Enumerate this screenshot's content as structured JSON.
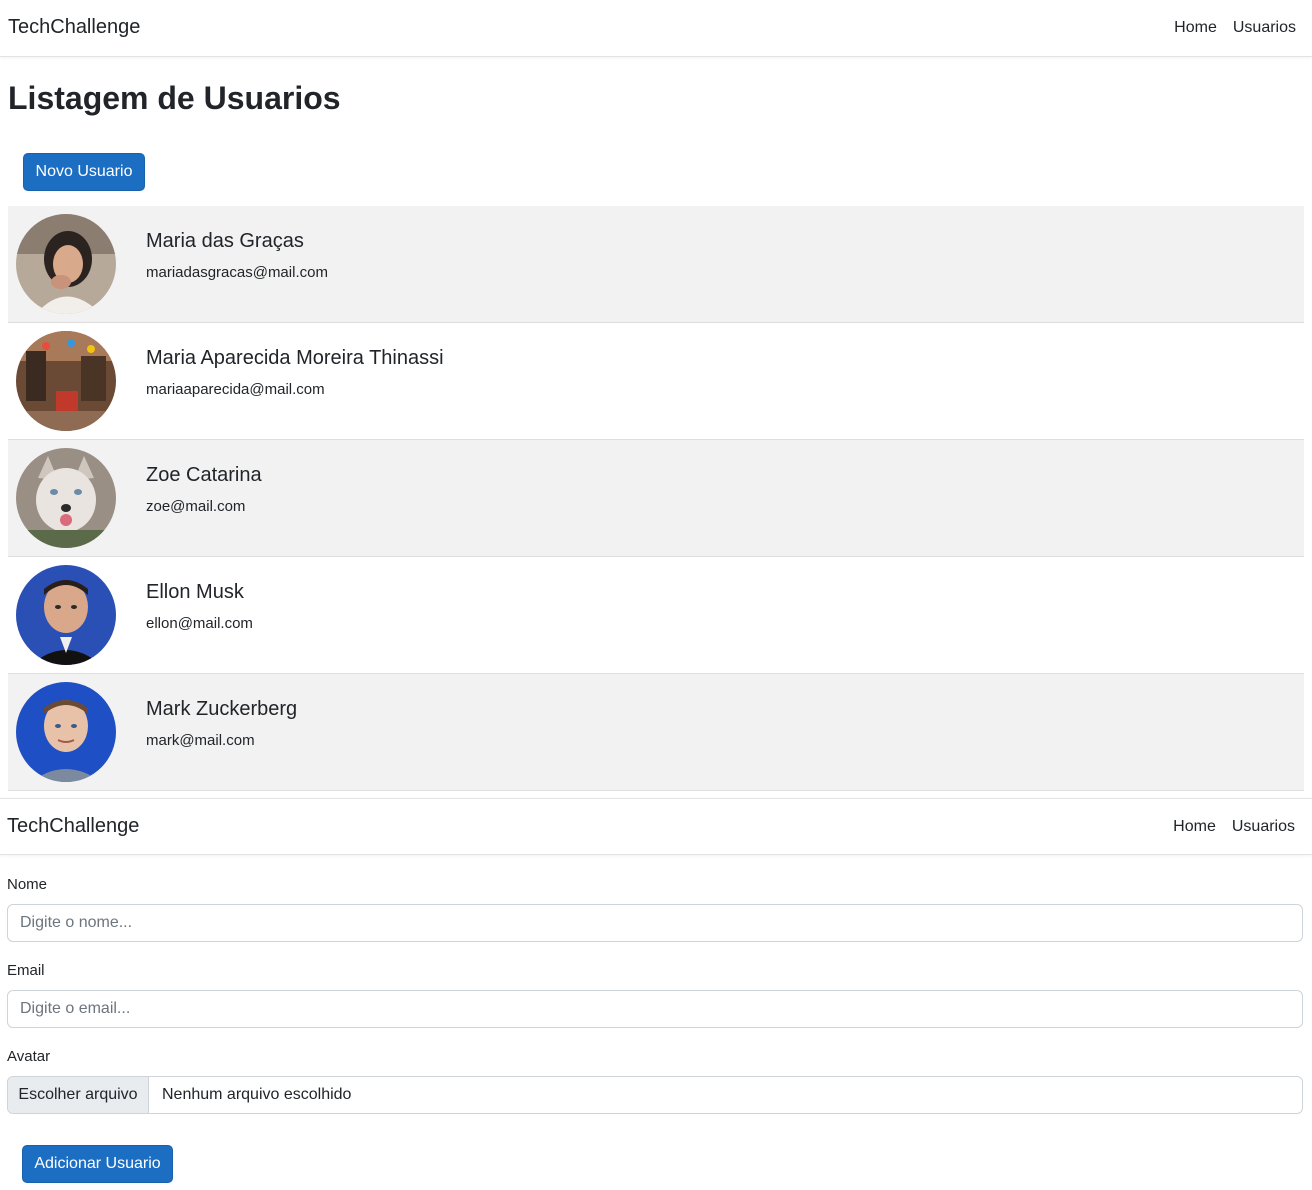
{
  "nav": {
    "brand": "TechChallenge",
    "links": [
      "Home",
      "Usuarios"
    ]
  },
  "listing": {
    "title": "Listagem de Usuarios",
    "new_user_button": "Novo Usuario",
    "users": [
      {
        "name": "Maria das Graças",
        "email": "mariadasgracas@mail.com"
      },
      {
        "name": "Maria Aparecida Moreira Thinassi",
        "email": "mariaaparecida@mail.com"
      },
      {
        "name": "Zoe Catarina",
        "email": "zoe@mail.com"
      },
      {
        "name": "Ellon Musk",
        "email": "ellon@mail.com"
      },
      {
        "name": "Mark Zuckerberg",
        "email": "mark@mail.com"
      }
    ]
  },
  "form": {
    "nome_label": "Nome",
    "nome_placeholder": "Digite o nome...",
    "email_label": "Email",
    "email_placeholder": "Digite o email...",
    "avatar_label": "Avatar",
    "file_button": "Escolher arquivo",
    "file_status": "Nenhum arquivo escolhido",
    "submit_button": "Adicionar Usuario"
  },
  "colors": {
    "primary": "#1b6ec2",
    "row_shade": "#f2f2f2"
  }
}
